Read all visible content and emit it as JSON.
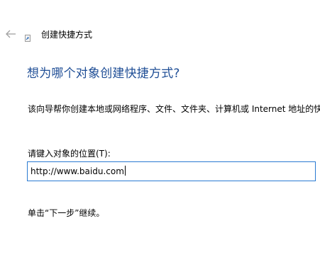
{
  "wizard": {
    "title": "创建快捷方式",
    "heading": "想为哪个对象创建快捷方式?",
    "description": "该向导帮你创建本地或网络程序、文件、文件夹、计算机或 Internet 地址的快",
    "location_label": "请键入对象的位置(T):",
    "location_value": "http://www.baidu.com",
    "next_hint": "单击“下一步”继续。"
  },
  "icons": {
    "back": "back-arrow-icon",
    "shortcut": "shortcut-icon"
  },
  "colors": {
    "heading": "#1f4e96",
    "focus_border": "#2a7ad2",
    "back_arrow": "#a0a0a0"
  }
}
